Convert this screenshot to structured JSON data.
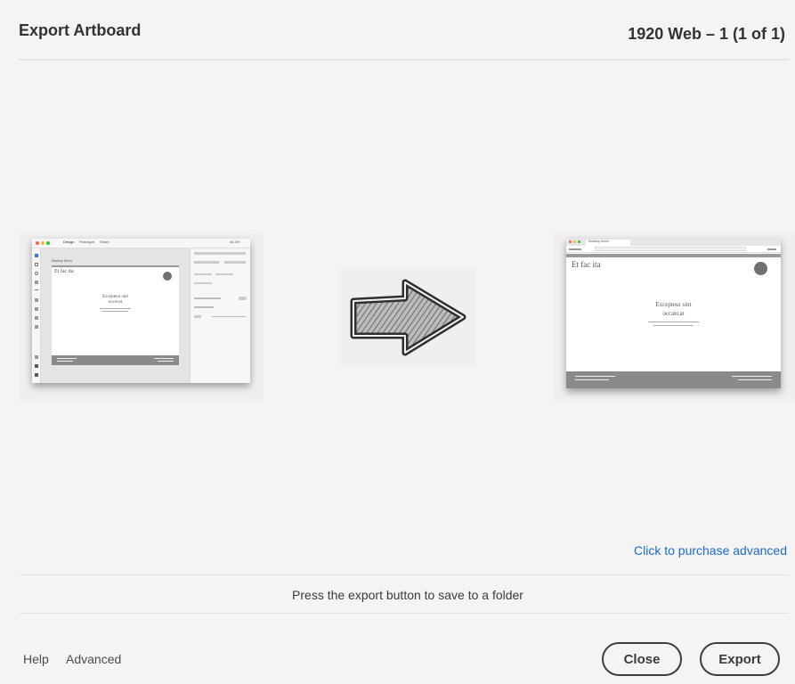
{
  "dialog": {
    "title": "Export Artboard",
    "artboard_name": "1920 Web – 1 (1 of 1)"
  },
  "preview": {
    "source_thumb": {
      "tabs": [
        "Design",
        "Prototype",
        "Share"
      ],
      "zoom": "46.3%",
      "artboard_label": "Desktop Demo",
      "heading": "Et fac ita",
      "center_title_line1": "Excepteur sint",
      "center_title_line2": "occecat"
    },
    "result_thumb": {
      "tab_label": "Desktop Demo",
      "heading": "Et fac ita",
      "center_title_line1": "Excepteur sint",
      "center_title_line2": "occaecat"
    },
    "arrow_icon": "right-arrow-icon"
  },
  "purchase_link": "Click to purchase advanced",
  "status_text": "Press the export button to save to a folder",
  "footer": {
    "help": "Help",
    "advanced": "Advanced",
    "close": "Close",
    "export": "Export"
  }
}
